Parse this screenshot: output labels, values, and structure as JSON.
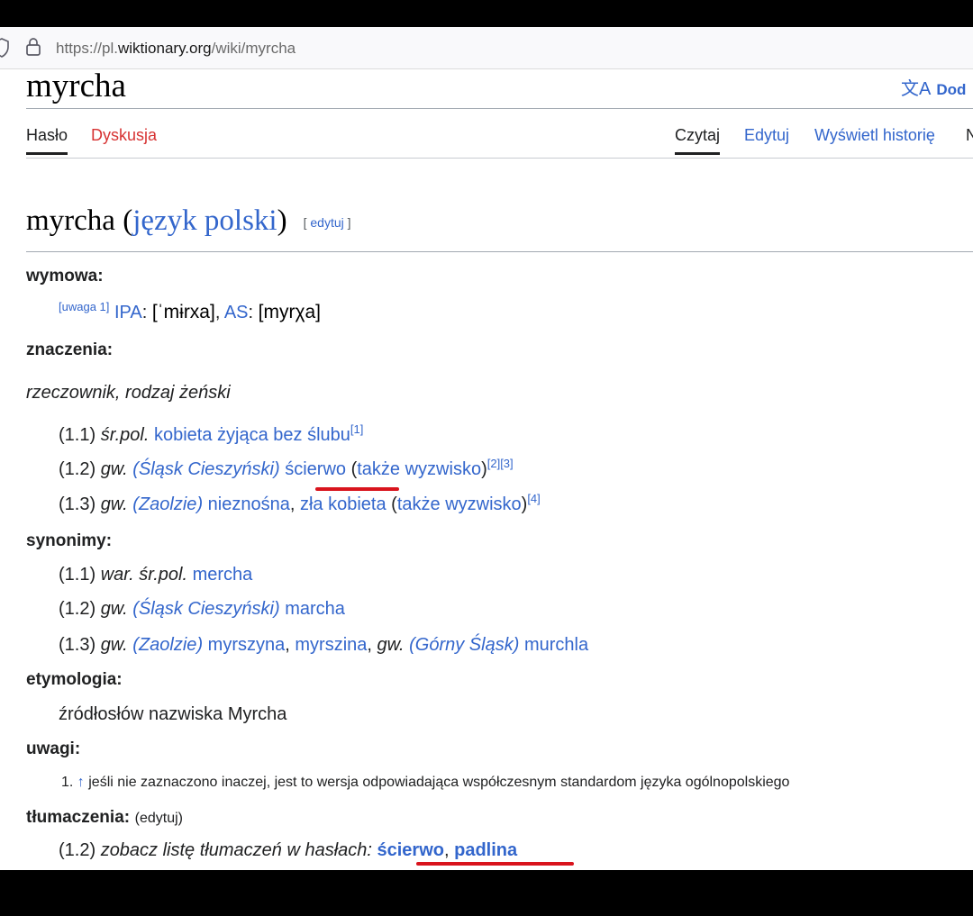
{
  "browser": {
    "url_prefix": "https://pl.",
    "url_domain": "wiktionary.org",
    "url_path": "/wiki/myrcha"
  },
  "page": {
    "title": "myrcha",
    "lang_button": "Dod",
    "tabs_left": [
      "Hasło",
      "Dyskusja"
    ],
    "tabs_right": [
      "Czytaj",
      "Edytuj",
      "Wyświetl historię",
      "N"
    ]
  },
  "entry": {
    "headword": "myrcha",
    "language": "język polski",
    "edit_label": "edytuj",
    "pronunciation_label": "wymowa:",
    "pron_note": "[uwaga 1]",
    "pron_ipa_label": "IPA",
    "pron_ipa": "[ˈmɨrxa]",
    "pron_as_label": "AS",
    "pron_as": "[myrχa]",
    "meanings_label": "znaczenia:",
    "part_of_speech": "rzeczownik, rodzaj żeński",
    "meanings": {
      "m1": {
        "num": "(1.1)",
        "qual": "śr.pol.",
        "text": "kobieta żyjąca bez ślubu",
        "ref": "[1]"
      },
      "m2": {
        "num": "(1.2)",
        "qual": "gw.",
        "region": "Śląsk Cieszyński",
        "text": "ścierwo",
        "also": "także wyzwisko",
        "ref": "[2][3]"
      },
      "m3": {
        "num": "(1.3)",
        "qual": "gw.",
        "region": "Zaolzie",
        "text1": "nieznośna",
        "text2": "zła kobieta",
        "also": "także wyzwisko",
        "ref": "[4]"
      }
    },
    "synonyms_label": "synonimy:",
    "synonyms": {
      "s1": {
        "num": "(1.1)",
        "qual": "war. śr.pol.",
        "word": "mercha"
      },
      "s2": {
        "num": "(1.2)",
        "qual": "gw.",
        "region": "Śląsk Cieszyński",
        "word": "marcha"
      },
      "s3": {
        "num": "(1.3)",
        "qual": "gw.",
        "region": "Zaolzie",
        "w1": "myrszyna",
        "w2": "myrszina",
        "qual2": "gw.",
        "region2": "Górny Śląsk",
        "w3": "murchla"
      }
    },
    "etymology_label": "etymologia:",
    "etymology": "źródłosłów nazwiska Myrcha",
    "notes_label": "uwagi:",
    "note1_num": "1.",
    "note1_arrow": "↑",
    "note1_text": "jeśli nie zaznaczono inaczej, jest to wersja odpowiadająca współczesnym standardom języka ogólnopolskiego",
    "translations_label": "tłumaczenia:",
    "translations_edit": "(edytuj)",
    "translation_num": "(1.2)",
    "translation_text": "zobacz listę tłumaczeń w hasłach:",
    "translation_link1": "ścierwo",
    "translation_link2": "padlina"
  },
  "colors": {
    "link": "#3366cc",
    "red_link": "#d73333",
    "annotation": "#d9141d"
  }
}
